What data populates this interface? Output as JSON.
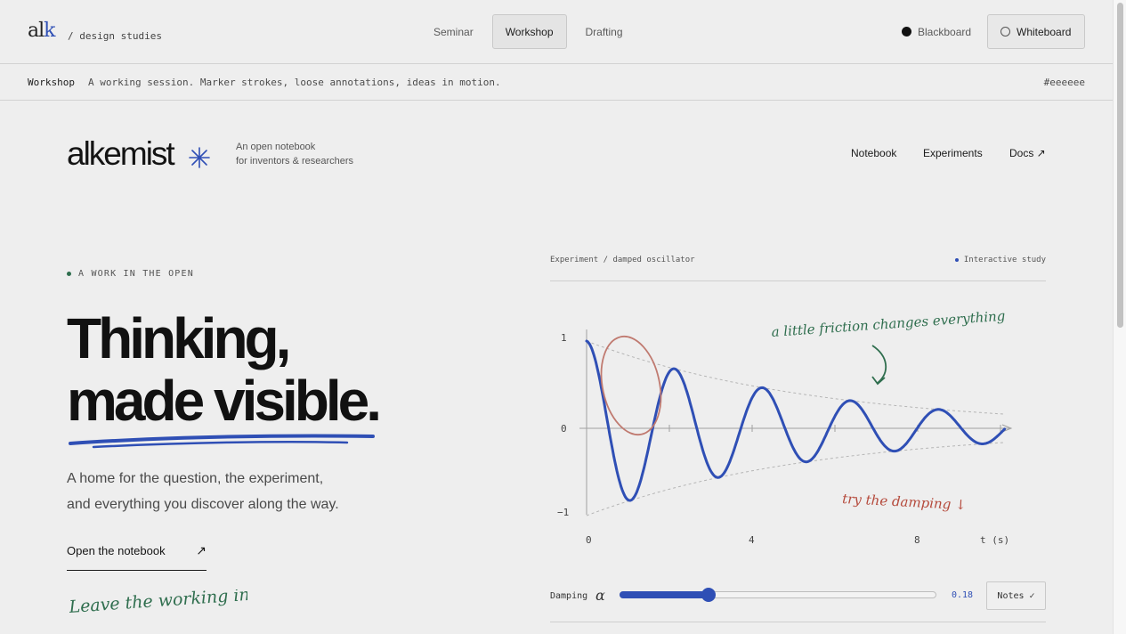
{
  "topbar": {
    "logo": "alk",
    "breadcrumb": "/ design studies",
    "modes": [
      {
        "label": "Seminar",
        "active": false
      },
      {
        "label": "Workshop",
        "active": true
      },
      {
        "label": "Drafting",
        "active": false
      }
    ],
    "themes": [
      {
        "label": "Blackboard",
        "selected": false
      },
      {
        "label": "Whiteboard",
        "selected": true
      }
    ]
  },
  "subbar": {
    "label": "Workshop",
    "description": "A working session. Marker strokes, loose annotations, ideas in motion.",
    "hex": "#eeeeee"
  },
  "header": {
    "brand": "alkemist",
    "tagline_line1": "An open notebook",
    "tagline_line2": "for inventors & researchers",
    "nav": [
      "Notebook",
      "Experiments",
      "Docs ↗"
    ]
  },
  "hero": {
    "eyebrow": "A WORK IN THE OPEN",
    "headline_line1": "Thinking,",
    "headline_line2": "made visible.",
    "lede_line1": "A home for the question, the experiment,",
    "lede_line2": "and everything you discover along the way.",
    "cta": "Open the notebook",
    "cta_arrow": "↗",
    "handwritten": "Leave the working in."
  },
  "experiment": {
    "title": "Experiment / damped oscillator",
    "badge": "Interactive study",
    "annotation_top": "a little friction changes everything",
    "annotation_bottom": "try the damping ↓",
    "y_ticks": [
      "1",
      "0",
      "−1"
    ],
    "x_ticks": [
      "0",
      "4",
      "8"
    ],
    "x_label": "t (s)",
    "control_label": "Damping",
    "control_symbol": "α",
    "damping_value": "0.18",
    "damping_fraction": 0.28,
    "notes_label": "Notes",
    "notes_icon": "✓"
  },
  "colors": {
    "background": "#eeeeee",
    "accent_blue": "#2f4fb5",
    "accent_green": "#2f6e4e",
    "accent_red": "#b54a3c"
  }
}
